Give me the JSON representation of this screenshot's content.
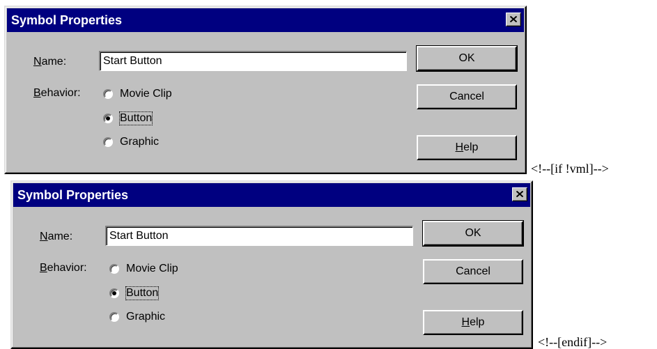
{
  "dialogs": [
    {
      "title": "Symbol Properties",
      "name_label_mnemonic": "N",
      "name_label_rest": "ame:",
      "name_value": "Start Button",
      "behavior_label_mnemonic": "B",
      "behavior_label_rest": "ehavior:",
      "options": [
        "Movie Clip",
        "Button",
        "Graphic"
      ],
      "selected_option": "Button",
      "buttons": {
        "ok": "OK",
        "cancel": "Cancel",
        "help_mnemonic": "H",
        "help_rest": "elp"
      }
    },
    {
      "title": "Symbol Properties",
      "name_label_mnemonic": "N",
      "name_label_rest": "ame:",
      "name_value": "Start Button",
      "behavior_label_mnemonic": "B",
      "behavior_label_rest": "ehavior:",
      "options": [
        "Movie Clip",
        "Button",
        "Graphic"
      ],
      "selected_option": "Button",
      "buttons": {
        "ok": "OK",
        "cancel": "Cancel",
        "help_mnemonic": "H",
        "help_rest": "elp"
      }
    }
  ],
  "comments": {
    "first": "<!--[if !vml]-->",
    "second": "<!--[endif]-->"
  },
  "colors": {
    "title_bar": "#000080",
    "dialog_face": "#c0c0c0",
    "title_text": "#ffffff"
  },
  "icons": {
    "close": "close-icon"
  }
}
